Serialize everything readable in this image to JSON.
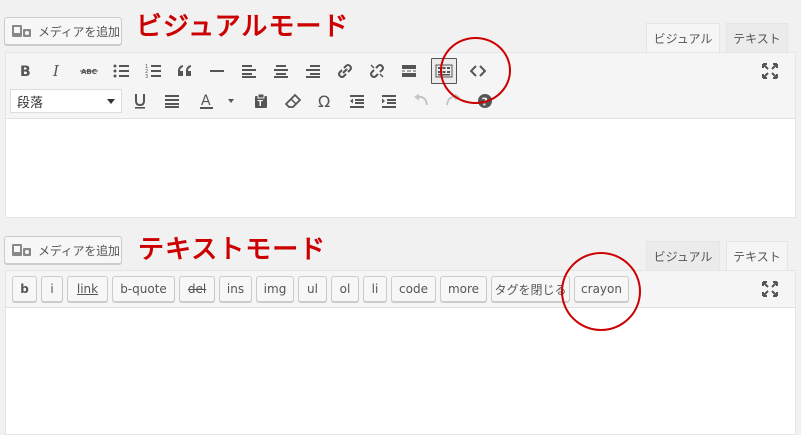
{
  "visual_section": {
    "title": "ビジュアルモード",
    "media_button_label": "メディアを追加",
    "tabs": [
      {
        "label": "ビジュアル",
        "active": true
      },
      {
        "label": "テキスト",
        "active": false
      }
    ],
    "toolbar_row1": [
      "bold-icon",
      "italic-icon",
      "strikethrough-icon",
      "bullet-list-icon",
      "numbered-list-icon",
      "blockquote-icon",
      "horizontal-line-icon",
      "align-left-icon",
      "align-center-icon",
      "align-right-icon",
      "insert-link-icon",
      "remove-link-icon",
      "read-more-icon",
      "toolbar-toggle-icon",
      "code-icon",
      "fullscreen-icon"
    ],
    "format_select_value": "段落",
    "toolbar_row2": [
      "underline-icon",
      "justify-icon",
      "text-color-icon",
      "paste-as-text-icon",
      "clear-formatting-icon",
      "special-character-icon",
      "decrease-indent-icon",
      "increase-indent-icon",
      "undo-icon",
      "redo-icon",
      "help-icon"
    ]
  },
  "text_section": {
    "title": "テキストモード",
    "media_button_label": "メディアを追加",
    "tabs": [
      {
        "label": "ビジュアル",
        "active": false
      },
      {
        "label": "テキスト",
        "active": true
      }
    ],
    "quicktags": [
      "b",
      "i",
      "link",
      "b-quote",
      "del",
      "ins",
      "img",
      "ul",
      "ol",
      "li",
      "code",
      "more",
      "タグを閉じる",
      "crayon"
    ]
  },
  "colors": {
    "annotation_red": "#cc0000",
    "toolbar_bg": "#f5f5f5",
    "page_bg": "#f1f1f1"
  }
}
